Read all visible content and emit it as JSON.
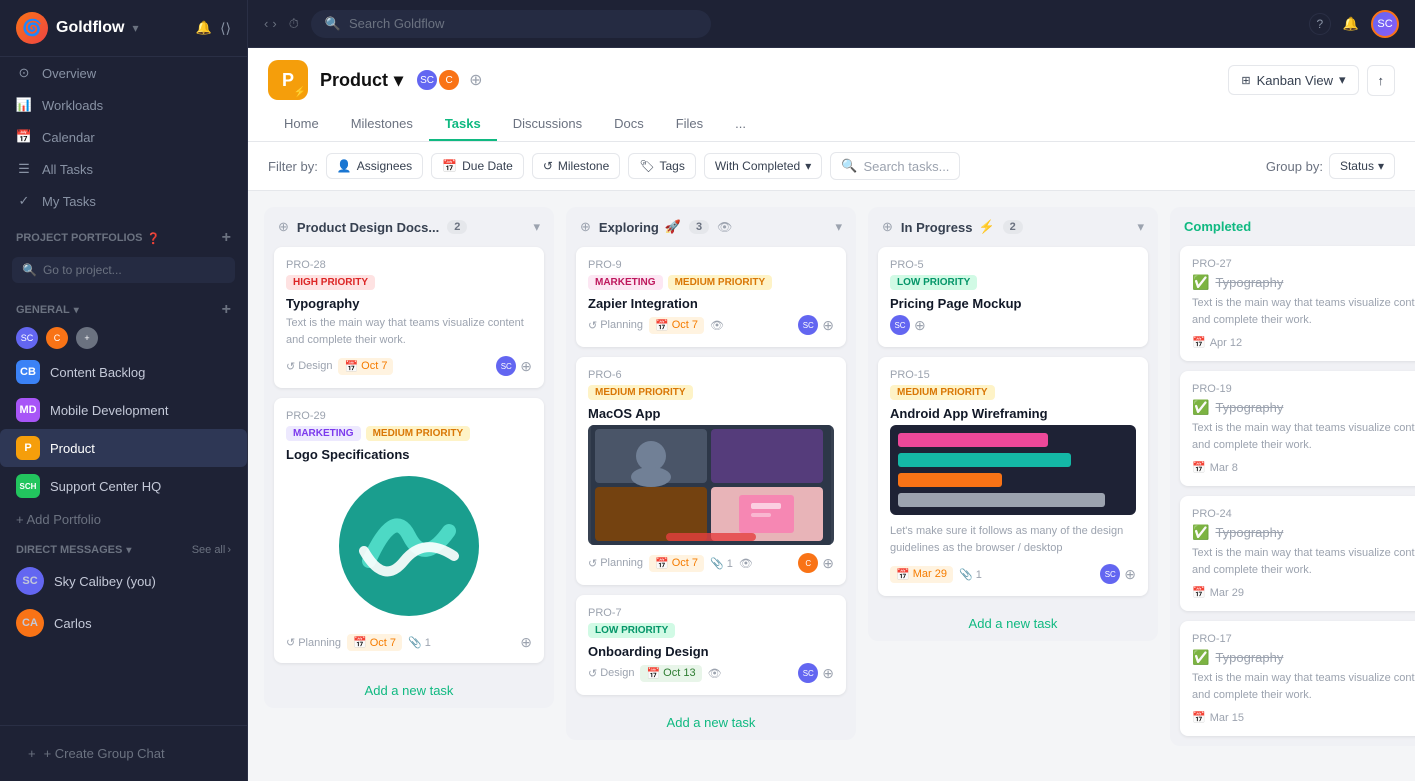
{
  "app": {
    "name": "Goldflow",
    "logo_char": "🌊"
  },
  "topbar": {
    "search_placeholder": "Search Goldflow",
    "question_icon": "?",
    "bell_icon": "🔔"
  },
  "sidebar": {
    "nav_items": [
      {
        "id": "overview",
        "label": "Overview",
        "icon": "⊙"
      },
      {
        "id": "workloads",
        "label": "Workloads",
        "icon": "📊"
      },
      {
        "id": "calendar",
        "label": "Calendar",
        "icon": "📅"
      },
      {
        "id": "all-tasks",
        "label": "All Tasks",
        "icon": "☰"
      },
      {
        "id": "my-tasks",
        "label": "My Tasks",
        "icon": "✓"
      }
    ],
    "section_general": "GENERAL",
    "search_placeholder": "Go to project...",
    "portfolios": [
      {
        "id": "content-backlog",
        "label": "Content Backlog",
        "color": "#3b82f6",
        "char": "CB"
      },
      {
        "id": "mobile-development",
        "label": "Mobile Development",
        "color": "#a855f7",
        "char": "MD"
      },
      {
        "id": "product",
        "label": "Product",
        "color": "#f59e0b",
        "char": "P",
        "active": true
      },
      {
        "id": "support-center-hq",
        "label": "Support Center HQ",
        "color": "#22c55e",
        "char": "SCH"
      }
    ],
    "add_portfolio": "+ Add Portfolio",
    "dm_section": "DIRECT MESSAGES",
    "see_all": "See all",
    "dm_items": [
      {
        "id": "sky-calibey",
        "label": "Sky Calibey (you)",
        "color": "#6366f1"
      },
      {
        "id": "carlos",
        "label": "Carlos",
        "color": "#f97316"
      }
    ],
    "create_group_btn": "+ Create Group Chat"
  },
  "project": {
    "name": "Product",
    "icon_char": "P",
    "icon_color": "#f59e0b",
    "tabs": [
      "Home",
      "Milestones",
      "Tasks",
      "Discussions",
      "Docs",
      "Files",
      "..."
    ],
    "active_tab": "Tasks",
    "kanban_view": "Kanban View",
    "share_icon": "↑"
  },
  "filters": {
    "label": "Filter by:",
    "assignees": "Assignees",
    "due_date": "Due Date",
    "milestone": "Milestone",
    "tags": "Tags",
    "with_completed": "With Completed",
    "search_placeholder": "Search tasks...",
    "group_by_label": "Group by:",
    "group_by_value": "Status"
  },
  "columns": [
    {
      "id": "product-design-docs",
      "title": "Product Design Docs...",
      "count": 2,
      "color": "#374151",
      "icon": "person-plus",
      "tasks": [
        {
          "id": "PRO-28",
          "title": "Typography",
          "tags": [
            {
              "label": "HIGH PRIORITY",
              "class": "tag-high"
            }
          ],
          "desc": "Text is the main way that teams visualize content and complete their work.",
          "milestone": "Design",
          "date": "Oct 7",
          "date_color": "orange",
          "has_avatar": true
        },
        {
          "id": "PRO-29",
          "title": "Logo Specifications",
          "tags": [
            {
              "label": "MARKETING",
              "class": "tag-marketing"
            },
            {
              "label": "MEDIUM PRIORITY",
              "class": "tag-medium"
            }
          ],
          "desc": "",
          "has_logo_image": true,
          "milestone": "Planning",
          "date": "Oct 7",
          "date_color": "orange",
          "attachment": "1"
        }
      ],
      "add_task": "Add a new task"
    },
    {
      "id": "exploring",
      "title": "Exploring",
      "count": 3,
      "color": "#374151",
      "icon": "person-plus",
      "tasks": [
        {
          "id": "PRO-9",
          "title": "Zapier Integration",
          "tags": [
            {
              "label": "MARKETING",
              "class": "tag-marketing2"
            },
            {
              "label": "MEDIUM PRIORITY",
              "class": "tag-medium"
            }
          ],
          "desc": "",
          "milestone": "Planning",
          "date": "Oct 7",
          "date_color": "orange",
          "has_eye": true,
          "has_avatar": true
        },
        {
          "id": "PRO-6",
          "title": "MacOS App",
          "tags": [
            {
              "label": "MEDIUM PRIORITY",
              "class": "tag-medium"
            }
          ],
          "desc": "",
          "has_video_image": true,
          "milestone": "Planning",
          "date": "Oct 7",
          "date_color": "orange",
          "attachment": "1",
          "has_eye": true,
          "has_avatar": true
        },
        {
          "id": "PRO-7",
          "title": "Onboarding Design",
          "tags": [
            {
              "label": "LOW PRIORITY",
              "class": "tag-low"
            }
          ],
          "desc": "",
          "milestone": "Design",
          "date": "Oct 13",
          "date_color": "green",
          "has_eye": true,
          "has_avatar": true
        }
      ],
      "add_task": "Add a new task"
    },
    {
      "id": "in-progress",
      "title": "In Progress",
      "count": 2,
      "color": "#374151",
      "icon": "person-plus",
      "lightning": "⚡",
      "tasks": [
        {
          "id": "PRO-5",
          "title": "Pricing Page Mockup",
          "tags": [
            {
              "label": "LOW PRIORITY",
              "class": "tag-low"
            }
          ],
          "desc": "",
          "has_avatar": true
        },
        {
          "id": "PRO-15",
          "title": "Android App Wireframing",
          "tags": [
            {
              "label": "MEDIUM PRIORITY",
              "class": "tag-medium"
            }
          ],
          "desc": "Let's make sure it follows as many of the design guidelines as the browser / desktop",
          "has_chart": true,
          "date": "Mar 29",
          "date_color": "orange",
          "attachment": "1",
          "has_avatar": true
        }
      ],
      "add_task": "Add a new task"
    },
    {
      "id": "completed",
      "title": "Completed",
      "color": "#10b981",
      "tasks": [
        {
          "id": "PRO-27",
          "title": "Typography",
          "desc": "Text is the main way that teams visualize content and complete their work.",
          "date": "Apr 12"
        },
        {
          "id": "PRO-19",
          "title": "Typography",
          "desc": "Text is the main way that teams visualize content and complete their work.",
          "date": "Mar 8"
        },
        {
          "id": "PRO-24",
          "title": "Typography",
          "desc": "Text is the main way that teams visualize content and complete their work.",
          "date": "Mar 29"
        },
        {
          "id": "PRO-17",
          "title": "Typography",
          "desc": "Text is the main way that teams visualize content and complete their work.",
          "date": "Mar 15"
        }
      ]
    }
  ]
}
